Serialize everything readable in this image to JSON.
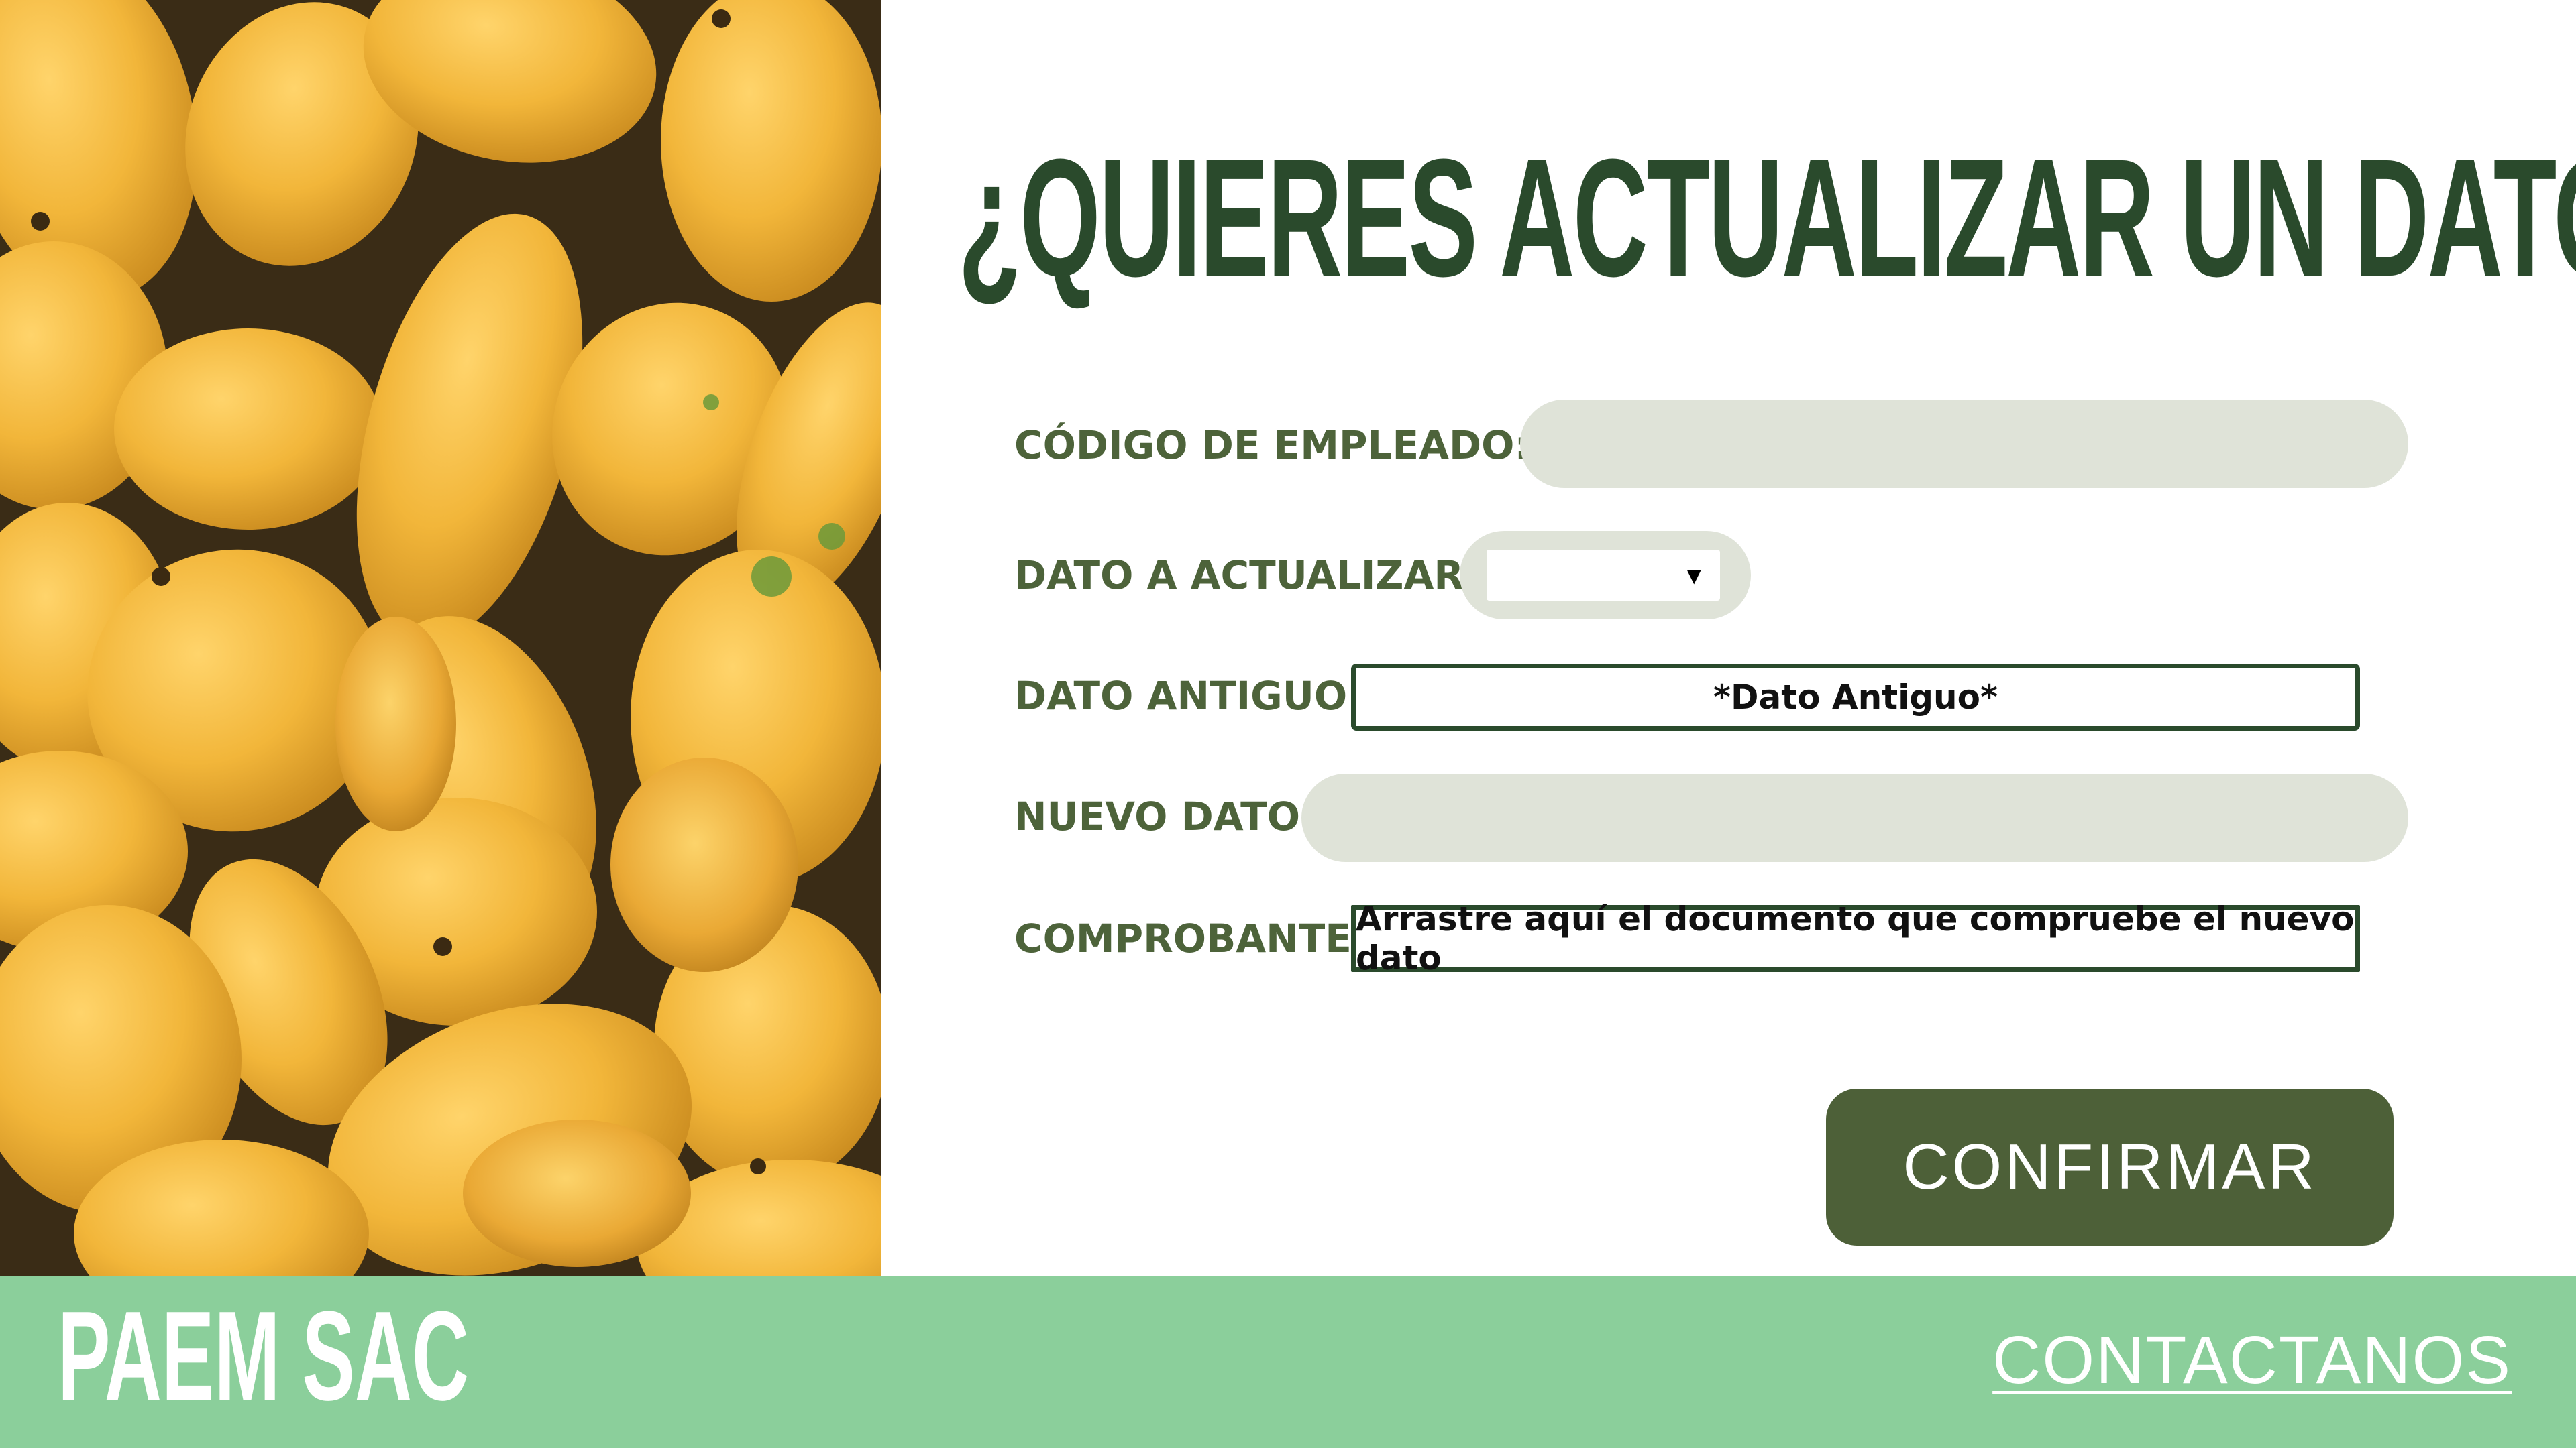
{
  "headline": "¿QUIERES ACTUALIZAR UN DATO?",
  "form": {
    "employee_code": {
      "label": "CÓDIGO DE EMPLEADO:",
      "value": ""
    },
    "field_to_update": {
      "label": "DATO A ACTUALIZAR:",
      "selected": ""
    },
    "old_value": {
      "label": "DATO ANTIGUO:",
      "value": "*Dato Antiguo*"
    },
    "new_value": {
      "label": "NUEVO DATO:",
      "value": ""
    },
    "receipt": {
      "label": "COMPROBANTE:",
      "dropzone_text": "Arrastre aquí el documento que compruebe el nuevo dato"
    },
    "confirm_label": "CONFIRMAR"
  },
  "footer": {
    "brand": "PAEM SAC",
    "contact_label": "CONTACTANOS"
  },
  "colors": {
    "headline": "#2a4a2c",
    "label": "#4d633a",
    "input_bg": "#dfe3d8",
    "button": "#4d6038",
    "footer": "#8bcf9b"
  },
  "icons": {
    "select_arrow": "caret-down-icon"
  }
}
